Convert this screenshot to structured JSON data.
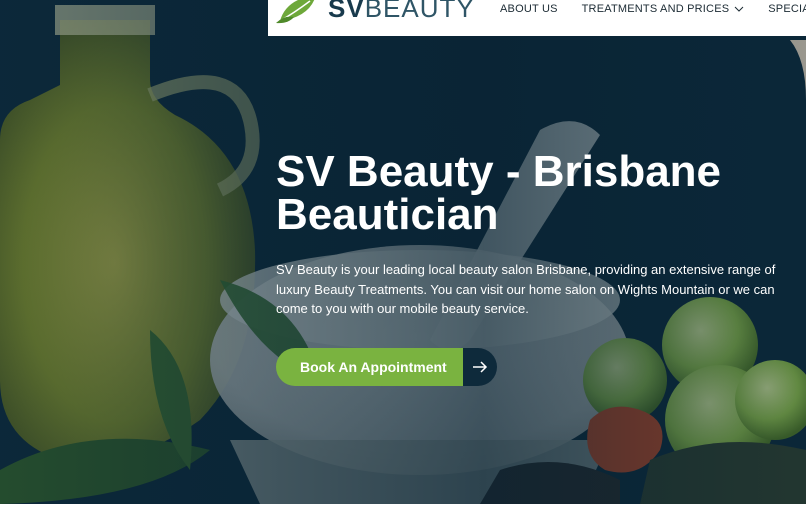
{
  "brand": {
    "logo_prefix": "SV",
    "logo_suffix": "BEAUTY"
  },
  "nav": {
    "items": [
      {
        "label": "ABOUT US",
        "has_dropdown": false
      },
      {
        "label": "TREATMENTS AND PRICES",
        "has_dropdown": true
      },
      {
        "label": "SPECIAL O",
        "has_dropdown": false
      }
    ]
  },
  "hero": {
    "title": "SV Beauty - Brisbane Beautician",
    "description": "SV Beauty is your leading local beauty salon Brisbane, providing an extensive range of luxury Beauty Treatments. You can visit our home salon on Wights Mountain or we can come to you with our mobile beauty service.",
    "cta_label": "Book An Appointment",
    "cta_icon": "arrow-right-icon"
  },
  "colors": {
    "accent_green": "#7ab340",
    "dark_navy": "#0e2a3b",
    "overlay": "#0b2738",
    "text_white": "#ffffff"
  }
}
